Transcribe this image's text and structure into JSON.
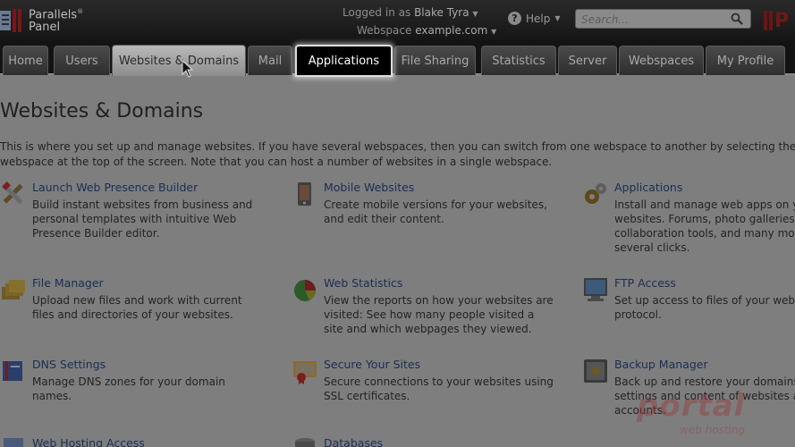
{
  "header": {
    "logo_line1": "Parallels",
    "logo_sup": "®",
    "logo_line2": "Panel",
    "logged_in_label": "Logged in as",
    "user_name": "Blake Tyra",
    "webspace_label": "Webspace",
    "webspace_value": "example.com",
    "help_label": "Help",
    "search_placeholder": "Search...",
    "brand_letter": "P"
  },
  "tabs": [
    {
      "label": "Home",
      "state": "normal"
    },
    {
      "label": "Users",
      "state": "normal"
    },
    {
      "label": "Websites & Domains",
      "state": "active"
    },
    {
      "label": "Mail",
      "state": "normal"
    },
    {
      "label": "Applications",
      "state": "highlighted"
    },
    {
      "label": "File Sharing",
      "state": "normal"
    },
    {
      "label": "Statistics",
      "state": "normal"
    },
    {
      "label": "Server",
      "state": "normal"
    },
    {
      "label": "Webspaces",
      "state": "normal"
    },
    {
      "label": "My Profile",
      "state": "normal"
    }
  ],
  "main": {
    "title": "Websites & Domains",
    "intro_line1": "This is where you set up and manage websites. If you have several webspaces, then you can switch from one webspace to another by selecting the requ",
    "intro_line2": "webspace at the top of the screen. Note that you can host a number of websites in a single webspace.",
    "items": [
      {
        "title": "Launch Web Presence Builder",
        "desc": "Build instant websites from business and personal templates with intuitive Web Presence Builder editor.",
        "icon": "tools-icon"
      },
      {
        "title": "Mobile Websites",
        "desc": "Create mobile versions for your websites, and edit their content.",
        "icon": "mobile-phone-icon"
      },
      {
        "title": "Applications",
        "desc": "Install and manage web apps on yo websites. Forums, photo galleries, collaboration tools, and many more in several clicks.",
        "icon": "gears-icon"
      },
      {
        "title": "File Manager",
        "desc": "Upload new files and work with current files and directories of your websites.",
        "icon": "folders-icon"
      },
      {
        "title": "Web Statistics",
        "desc": "View the reports on how your websites are visited: See how many people visited a site and which webpages they viewed.",
        "icon": "pie-chart-icon"
      },
      {
        "title": "FTP Access",
        "desc": "Set up access to files of your webs FTP protocol.",
        "icon": "ftp-monitor-icon"
      },
      {
        "title": "DNS Settings",
        "desc": "Manage DNS zones for your domain names.",
        "icon": "dns-book-icon"
      },
      {
        "title": "Secure Your Sites",
        "desc": "Secure connections to your websites using SSL certificates.",
        "icon": "certificate-icon"
      },
      {
        "title": "Backup Manager",
        "desc": "Back up and restore your domains, settings and content of websites a accounts.",
        "icon": "safe-icon"
      },
      {
        "title": "Web Hosting Access",
        "desc": "",
        "icon": "hosting-icon"
      },
      {
        "title": "Databases",
        "desc": "",
        "icon": "database-icon"
      }
    ]
  },
  "watermark": {
    "text": "portal",
    "sub": "web hosting"
  },
  "colors": {
    "header_bg": "#151515",
    "tab_highlight": "#000000",
    "content_dim": "#7e7e7e",
    "link": "#1a2e55",
    "brand": "#6e1818"
  }
}
